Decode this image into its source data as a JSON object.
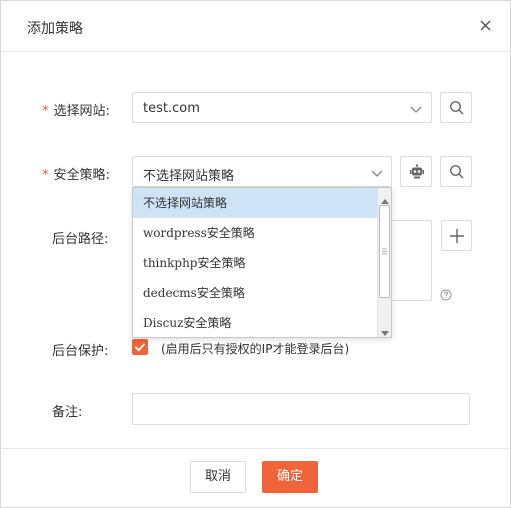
{
  "dialog": {
    "title": "添加策略",
    "close_icon": "close-icon"
  },
  "form": {
    "site": {
      "label": "选择网站:",
      "required": true,
      "value": "test.com"
    },
    "policy": {
      "label": "安全策略:",
      "required": true,
      "value": "不选择网站策略",
      "options": [
        "不选择网站策略",
        "wordpress安全策略",
        "thinkphp安全策略",
        "dedecms安全策略",
        "Discuz安全策略"
      ],
      "highlighted_index": 0
    },
    "backend_path": {
      "label": "后台路径:"
    },
    "backend_protect": {
      "label": "后台保护:",
      "checked": true,
      "description": "(启用后只有授权的IP才能登录后台)"
    },
    "note": {
      "label": "备注:",
      "value": ""
    }
  },
  "footer": {
    "cancel_label": "取消",
    "confirm_label": "确定"
  },
  "colors": {
    "accent": "#f0643a",
    "required": "#e64b4b",
    "option_highlight": "#cfe3f7"
  }
}
